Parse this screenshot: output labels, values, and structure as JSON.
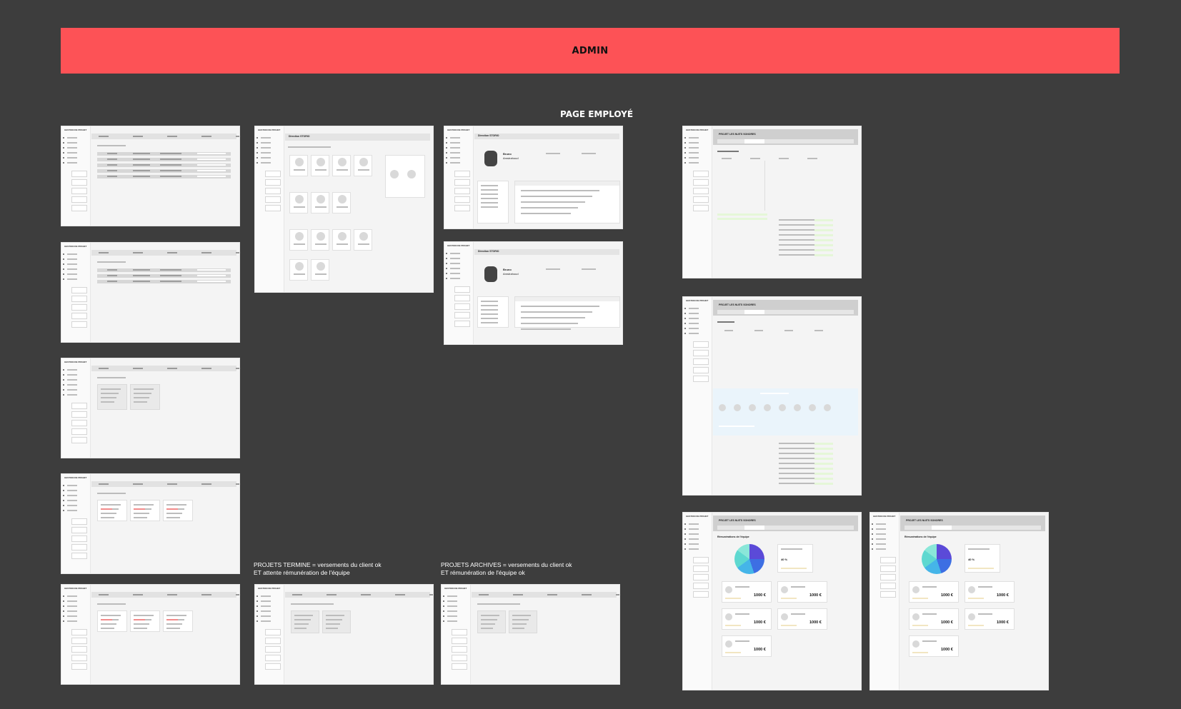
{
  "banner": {
    "title": "ADMIN"
  },
  "labels": {
    "page_employe": "PAGE EMPLOYÉ",
    "projets_termine": [
      "PROJETS TERMINE = versements du client ok",
      "ET attente rémunération de l'équipe"
    ],
    "projets_archives": [
      "PROJETS ARCHIVES = versements du client ok",
      "ET rémunération de l'équipe ok"
    ]
  },
  "frames": {
    "sidebar_title": "GESTION DE PROJET",
    "employee_header": "Direction STORIO",
    "employee_first_name": "Bruno",
    "employee_last_name": "Amstrahoud",
    "project_title": "PROJET LES NUITS SONORES",
    "remuneration_title": "Rémunérations de l'équipe",
    "amount": "1000 €",
    "percent": "40 %"
  },
  "colors": {
    "background": "#3d3d3d",
    "banner": "#fd5256"
  }
}
